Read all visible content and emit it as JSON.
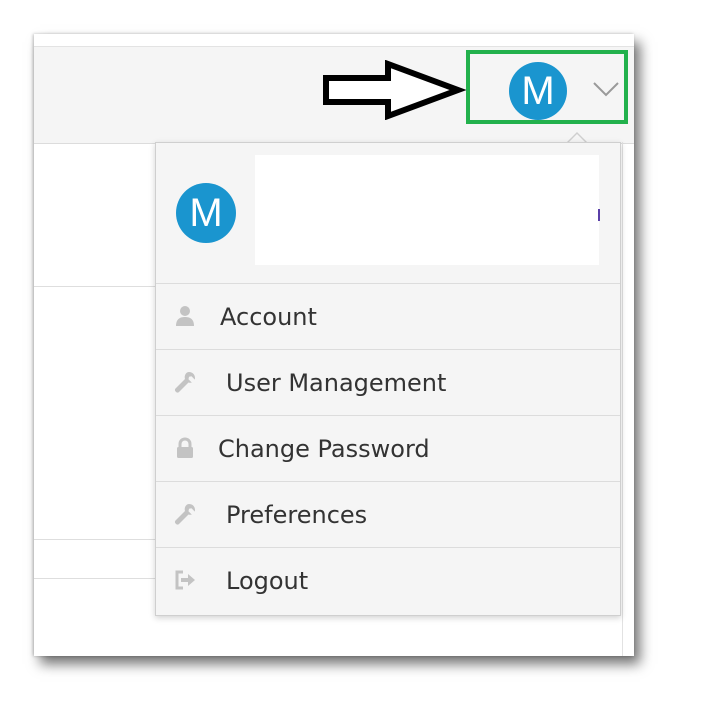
{
  "header": {
    "avatar_initial": "M"
  },
  "profile": {
    "avatar_initial": "M"
  },
  "menu": {
    "items": [
      {
        "label": "Account",
        "icon": "user-icon"
      },
      {
        "label": "User Management",
        "icon": "wrench-icon"
      },
      {
        "label": "Change Password",
        "icon": "lock-icon"
      },
      {
        "label": "Preferences",
        "icon": "wrench-icon"
      },
      {
        "label": "Logout",
        "icon": "sign-out-icon"
      }
    ]
  },
  "colors": {
    "avatar": "#1a95cf",
    "highlight": "#22b14c",
    "icon": "#c3c3c3",
    "text": "#333333"
  }
}
